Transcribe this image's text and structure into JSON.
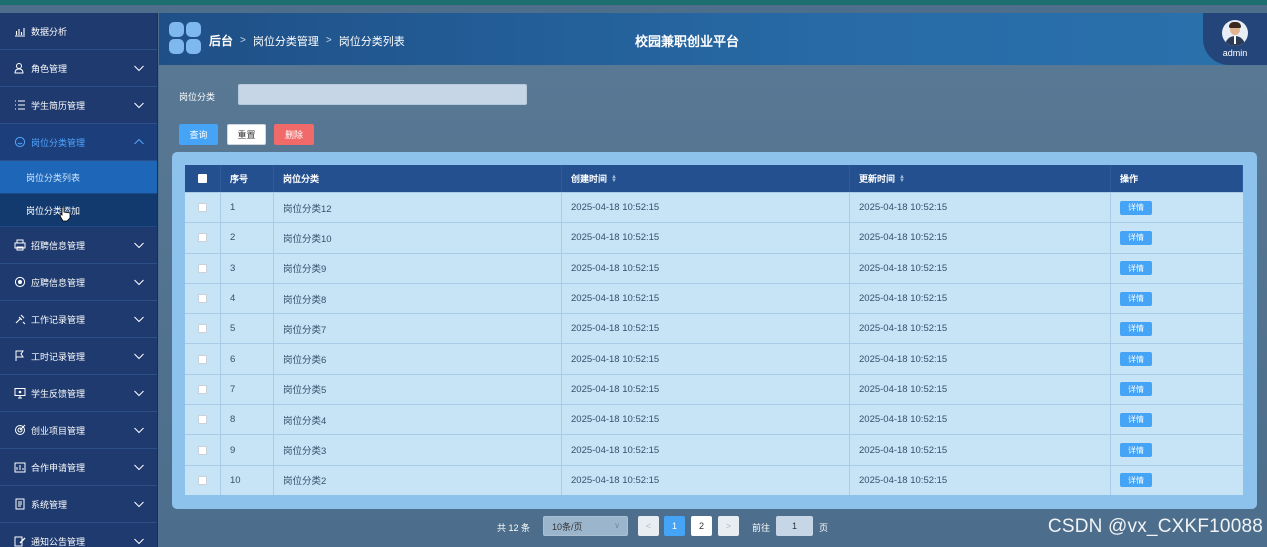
{
  "app": {
    "title": "校园兼职创业平台"
  },
  "header": {
    "breadcrumb": [
      "后台",
      "岗位分类管理",
      "岗位分类列表"
    ],
    "user": "admin"
  },
  "sidebar": {
    "items": [
      {
        "label": "数据分析",
        "icon": "chart-icon",
        "expandable": false
      },
      {
        "label": "角色管理",
        "icon": "user-icon",
        "expandable": true
      },
      {
        "label": "学生简历管理",
        "icon": "list-icon",
        "expandable": true
      },
      {
        "label": "岗位分类管理",
        "icon": "smile-icon",
        "expandable": true,
        "expanded": true,
        "children": [
          {
            "label": "岗位分类列表",
            "active": true
          },
          {
            "label": "岗位分类添加"
          }
        ]
      },
      {
        "label": "招聘信息管理",
        "icon": "printer-icon",
        "expandable": true
      },
      {
        "label": "应聘信息管理",
        "icon": "circle-icon",
        "expandable": true
      },
      {
        "label": "工作记录管理",
        "icon": "tools-icon",
        "expandable": true
      },
      {
        "label": "工时记录管理",
        "icon": "flag-icon",
        "expandable": true
      },
      {
        "label": "学生反馈管理",
        "icon": "monitor-icon",
        "expandable": true
      },
      {
        "label": "创业项目管理",
        "icon": "target-icon",
        "expandable": true
      },
      {
        "label": "合作申请管理",
        "icon": "board-icon",
        "expandable": true
      },
      {
        "label": "系统管理",
        "icon": "doc-icon",
        "expandable": true
      },
      {
        "label": "通知公告管理",
        "icon": "edit-icon",
        "expandable": true
      }
    ]
  },
  "search": {
    "label": "岗位分类",
    "value": "",
    "placeholder": ""
  },
  "buttons": {
    "query": "查询",
    "reset": "重置",
    "delete": "删除"
  },
  "table": {
    "headers": {
      "index": "序号",
      "category": "岗位分类",
      "created": "创建时间",
      "updated": "更新时间",
      "actions": "操作"
    },
    "rows": [
      {
        "index": "1",
        "category": "岗位分类12",
        "created": "2025-04-18 10:52:15",
        "updated": "2025-04-18 10:52:15",
        "action": "详情"
      },
      {
        "index": "2",
        "category": "岗位分类10",
        "created": "2025-04-18 10:52:15",
        "updated": "2025-04-18 10:52:15",
        "action": "详情"
      },
      {
        "index": "3",
        "category": "岗位分类9",
        "created": "2025-04-18 10:52:15",
        "updated": "2025-04-18 10:52:15",
        "action": "详情"
      },
      {
        "index": "4",
        "category": "岗位分类8",
        "created": "2025-04-18 10:52:15",
        "updated": "2025-04-18 10:52:15",
        "action": "详情"
      },
      {
        "index": "5",
        "category": "岗位分类7",
        "created": "2025-04-18 10:52:15",
        "updated": "2025-04-18 10:52:15",
        "action": "详情"
      },
      {
        "index": "6",
        "category": "岗位分类6",
        "created": "2025-04-18 10:52:15",
        "updated": "2025-04-18 10:52:15",
        "action": "详情"
      },
      {
        "index": "7",
        "category": "岗位分类5",
        "created": "2025-04-18 10:52:15",
        "updated": "2025-04-18 10:52:15",
        "action": "详情"
      },
      {
        "index": "8",
        "category": "岗位分类4",
        "created": "2025-04-18 10:52:15",
        "updated": "2025-04-18 10:52:15",
        "action": "详情"
      },
      {
        "index": "9",
        "category": "岗位分类3",
        "created": "2025-04-18 10:52:15",
        "updated": "2025-04-18 10:52:15",
        "action": "详情"
      },
      {
        "index": "10",
        "category": "岗位分类2",
        "created": "2025-04-18 10:52:15",
        "updated": "2025-04-18 10:52:15",
        "action": "详情"
      }
    ]
  },
  "pagination": {
    "total": "共 12 条",
    "page_size": "10条/页",
    "prev": "<",
    "pages": [
      "1",
      "2"
    ],
    "current": "1",
    "next": ">",
    "goto_label": "前往",
    "goto_value": "1",
    "page_suffix": "页"
  },
  "watermark": "CSDN @vx_CXKF10088",
  "colors": {
    "accent": "#45a4f5",
    "danger": "#f06a6a",
    "sidebar": "#1f3a6e",
    "table_header": "#24508f"
  }
}
